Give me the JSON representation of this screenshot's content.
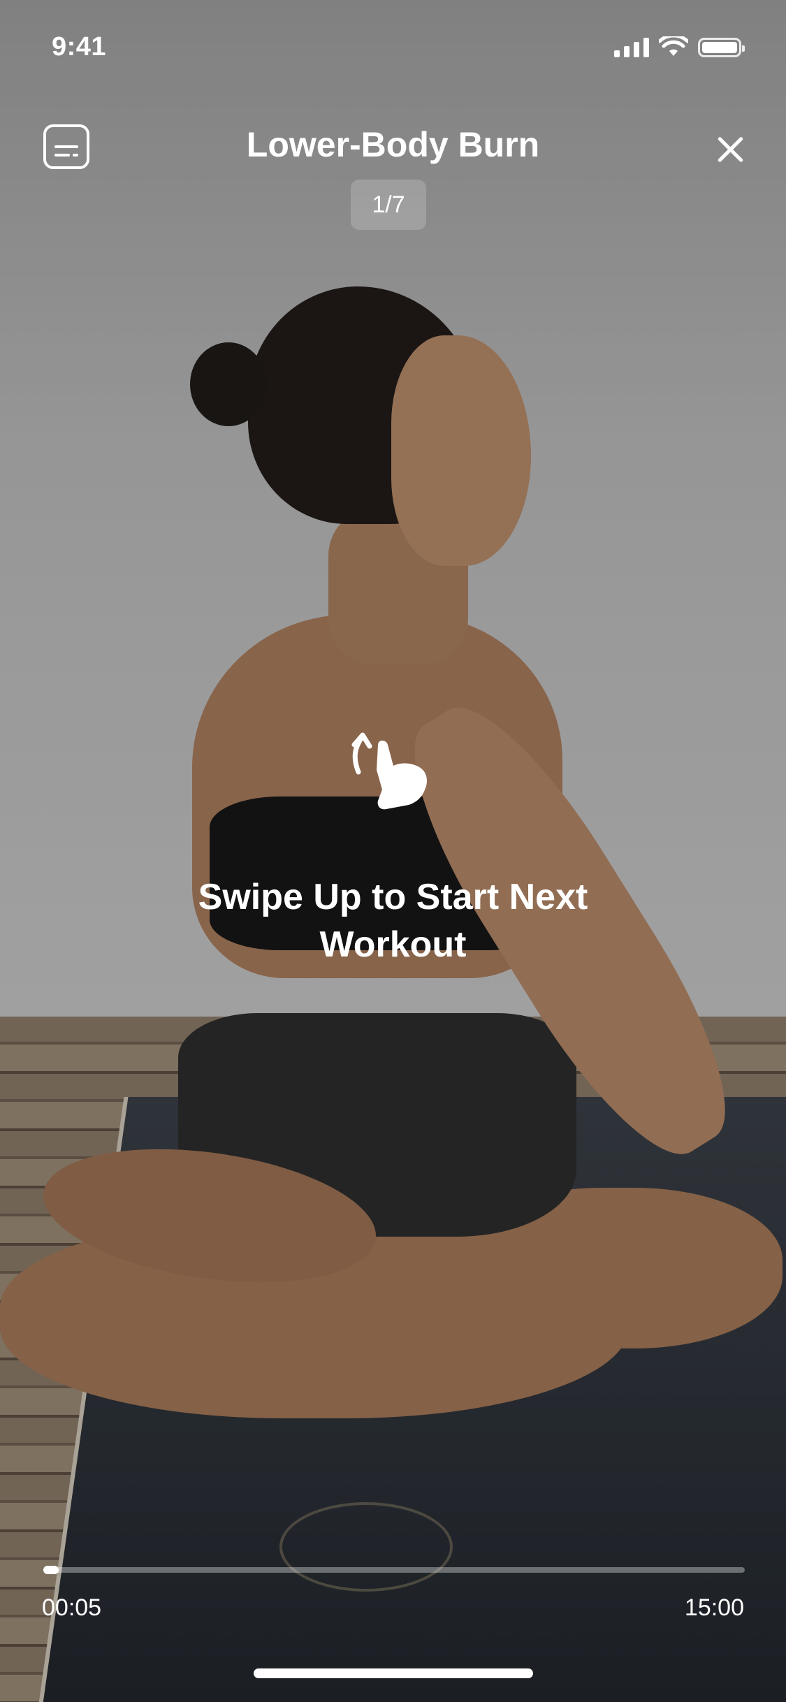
{
  "status_bar": {
    "time": "9:41"
  },
  "header": {
    "title": "Lower-Body Burn",
    "counter": "1/7"
  },
  "hint": {
    "text": "Swipe Up to Start Next Workout"
  },
  "playback": {
    "elapsed": "00:05",
    "duration": "15:00",
    "progress": 0.022
  },
  "icons": [
    "subtitles-icon",
    "close-icon",
    "swipe-up-hand-icon",
    "signal-icon",
    "wifi-icon",
    "battery-icon"
  ]
}
